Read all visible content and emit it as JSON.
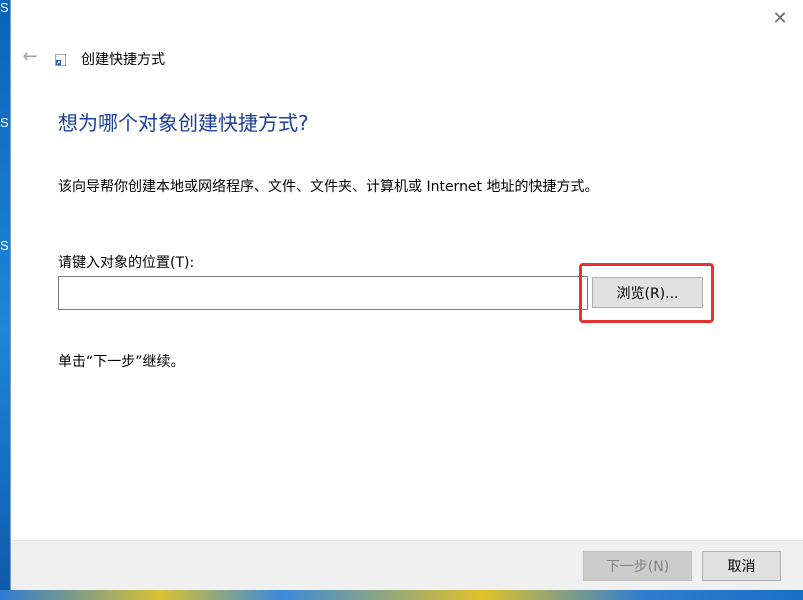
{
  "desktop": {
    "glyphs": [
      "S",
      "S",
      "S"
    ]
  },
  "window": {
    "title": "创建快捷方式",
    "close_icon": "close-icon",
    "back_icon": "back-arrow-icon"
  },
  "main": {
    "heading": "想为哪个对象创建快捷方式?",
    "description": "该向导帮你创建本地或网络程序、文件、文件夹、计算机或 Internet 地址的快捷方式。",
    "location_label": "请键入对象的位置(T):",
    "location_value": "",
    "browse_label": "浏览(R)...",
    "hint": "单击“下一步”继续。"
  },
  "footer": {
    "next_label": "下一步(N)",
    "cancel_label": "取消"
  },
  "colors": {
    "heading": "#1a3e9e",
    "highlight": "#e53232",
    "desktop": "#1a6fc4"
  }
}
